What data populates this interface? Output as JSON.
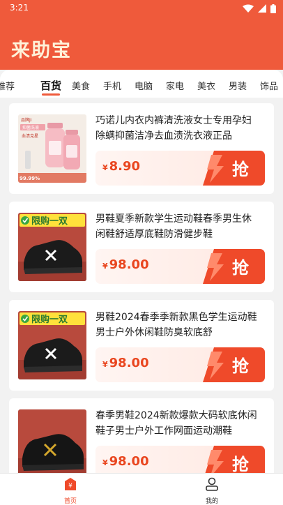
{
  "status_bar": {
    "time": "3:21"
  },
  "app": {
    "title": "来助宝",
    "accent": "#ef5a3b",
    "title_color": "#fff2d9"
  },
  "categories": [
    {
      "label": "推荐",
      "active": false
    },
    {
      "label": "百货",
      "active": true
    },
    {
      "label": "美食",
      "active": false
    },
    {
      "label": "手机",
      "active": false
    },
    {
      "label": "电脑",
      "active": false
    },
    {
      "label": "家电",
      "active": false
    },
    {
      "label": "美衣",
      "active": false
    },
    {
      "label": "男装",
      "active": false
    },
    {
      "label": "饰品",
      "active": false
    }
  ],
  "products": [
    {
      "title": "巧诺儿内衣内裤清洗液女士专用孕妇除螨抑菌洁净去血渍洗衣液正品",
      "currency": "¥",
      "price": "8.90",
      "button": "抢",
      "image": "pink-detergent-bottles",
      "image_text": {
        "brand": "品牌JI",
        "line1": "抑菌洗液",
        "line2": "血渍克星",
        "stat": "99.99%"
      }
    },
    {
      "title": "男鞋夏季新款学生运动鞋春季男生休闲鞋舒适厚底鞋防滑健步鞋",
      "currency": "¥",
      "price": "98.00",
      "button": "抢",
      "image": "black-sneaker",
      "image_text": {
        "badge": "限购一双"
      }
    },
    {
      "title": "男鞋2024春季季新款黑色学生运动鞋男士户外休闲鞋防臭软底舒",
      "currency": "¥",
      "price": "98.00",
      "button": "抢",
      "image": "black-sneaker",
      "image_text": {
        "badge": "限购一双"
      }
    },
    {
      "title": "春季男鞋2024新款爆款大码软底休闲鞋子男士户外工作网面运动潮鞋",
      "currency": "¥",
      "price": "98.00",
      "button": "抢",
      "image": "black-gold-sneaker",
      "image_text": {}
    }
  ],
  "bottom_nav": [
    {
      "label": "首页",
      "icon": "home-yen-icon",
      "active": true
    },
    {
      "label": "我的",
      "icon": "user-icon",
      "active": false
    }
  ]
}
